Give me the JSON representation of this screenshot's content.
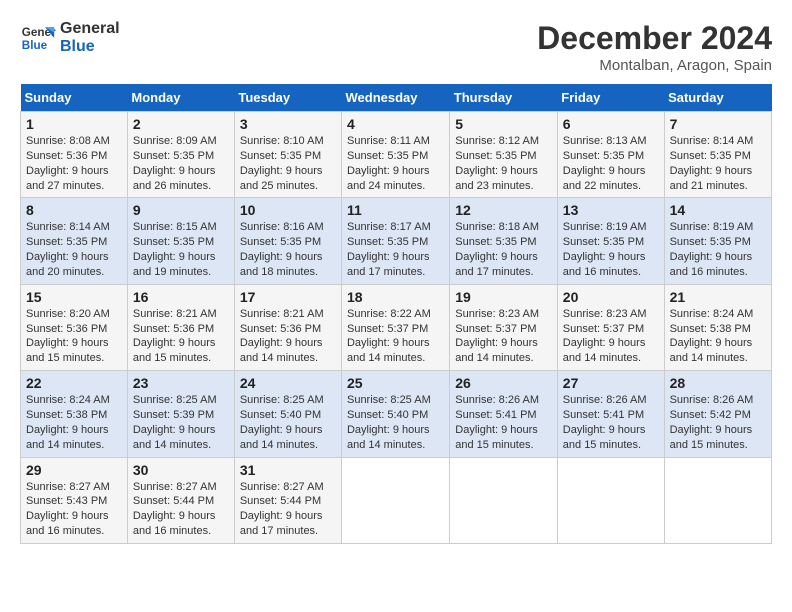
{
  "header": {
    "logo_line1": "General",
    "logo_line2": "Blue",
    "month": "December 2024",
    "location": "Montalban, Aragon, Spain"
  },
  "weekdays": [
    "Sunday",
    "Monday",
    "Tuesday",
    "Wednesday",
    "Thursday",
    "Friday",
    "Saturday"
  ],
  "weeks": [
    [
      {
        "day": "1",
        "sunrise": "Sunrise: 8:08 AM",
        "sunset": "Sunset: 5:36 PM",
        "daylight": "Daylight: 9 hours and 27 minutes."
      },
      {
        "day": "2",
        "sunrise": "Sunrise: 8:09 AM",
        "sunset": "Sunset: 5:35 PM",
        "daylight": "Daylight: 9 hours and 26 minutes."
      },
      {
        "day": "3",
        "sunrise": "Sunrise: 8:10 AM",
        "sunset": "Sunset: 5:35 PM",
        "daylight": "Daylight: 9 hours and 25 minutes."
      },
      {
        "day": "4",
        "sunrise": "Sunrise: 8:11 AM",
        "sunset": "Sunset: 5:35 PM",
        "daylight": "Daylight: 9 hours and 24 minutes."
      },
      {
        "day": "5",
        "sunrise": "Sunrise: 8:12 AM",
        "sunset": "Sunset: 5:35 PM",
        "daylight": "Daylight: 9 hours and 23 minutes."
      },
      {
        "day": "6",
        "sunrise": "Sunrise: 8:13 AM",
        "sunset": "Sunset: 5:35 PM",
        "daylight": "Daylight: 9 hours and 22 minutes."
      },
      {
        "day": "7",
        "sunrise": "Sunrise: 8:14 AM",
        "sunset": "Sunset: 5:35 PM",
        "daylight": "Daylight: 9 hours and 21 minutes."
      }
    ],
    [
      {
        "day": "8",
        "sunrise": "Sunrise: 8:14 AM",
        "sunset": "Sunset: 5:35 PM",
        "daylight": "Daylight: 9 hours and 20 minutes."
      },
      {
        "day": "9",
        "sunrise": "Sunrise: 8:15 AM",
        "sunset": "Sunset: 5:35 PM",
        "daylight": "Daylight: 9 hours and 19 minutes."
      },
      {
        "day": "10",
        "sunrise": "Sunrise: 8:16 AM",
        "sunset": "Sunset: 5:35 PM",
        "daylight": "Daylight: 9 hours and 18 minutes."
      },
      {
        "day": "11",
        "sunrise": "Sunrise: 8:17 AM",
        "sunset": "Sunset: 5:35 PM",
        "daylight": "Daylight: 9 hours and 17 minutes."
      },
      {
        "day": "12",
        "sunrise": "Sunrise: 8:18 AM",
        "sunset": "Sunset: 5:35 PM",
        "daylight": "Daylight: 9 hours and 17 minutes."
      },
      {
        "day": "13",
        "sunrise": "Sunrise: 8:19 AM",
        "sunset": "Sunset: 5:35 PM",
        "daylight": "Daylight: 9 hours and 16 minutes."
      },
      {
        "day": "14",
        "sunrise": "Sunrise: 8:19 AM",
        "sunset": "Sunset: 5:35 PM",
        "daylight": "Daylight: 9 hours and 16 minutes."
      }
    ],
    [
      {
        "day": "15",
        "sunrise": "Sunrise: 8:20 AM",
        "sunset": "Sunset: 5:36 PM",
        "daylight": "Daylight: 9 hours and 15 minutes."
      },
      {
        "day": "16",
        "sunrise": "Sunrise: 8:21 AM",
        "sunset": "Sunset: 5:36 PM",
        "daylight": "Daylight: 9 hours and 15 minutes."
      },
      {
        "day": "17",
        "sunrise": "Sunrise: 8:21 AM",
        "sunset": "Sunset: 5:36 PM",
        "daylight": "Daylight: 9 hours and 14 minutes."
      },
      {
        "day": "18",
        "sunrise": "Sunrise: 8:22 AM",
        "sunset": "Sunset: 5:37 PM",
        "daylight": "Daylight: 9 hours and 14 minutes."
      },
      {
        "day": "19",
        "sunrise": "Sunrise: 8:23 AM",
        "sunset": "Sunset: 5:37 PM",
        "daylight": "Daylight: 9 hours and 14 minutes."
      },
      {
        "day": "20",
        "sunrise": "Sunrise: 8:23 AM",
        "sunset": "Sunset: 5:37 PM",
        "daylight": "Daylight: 9 hours and 14 minutes."
      },
      {
        "day": "21",
        "sunrise": "Sunrise: 8:24 AM",
        "sunset": "Sunset: 5:38 PM",
        "daylight": "Daylight: 9 hours and 14 minutes."
      }
    ],
    [
      {
        "day": "22",
        "sunrise": "Sunrise: 8:24 AM",
        "sunset": "Sunset: 5:38 PM",
        "daylight": "Daylight: 9 hours and 14 minutes."
      },
      {
        "day": "23",
        "sunrise": "Sunrise: 8:25 AM",
        "sunset": "Sunset: 5:39 PM",
        "daylight": "Daylight: 9 hours and 14 minutes."
      },
      {
        "day": "24",
        "sunrise": "Sunrise: 8:25 AM",
        "sunset": "Sunset: 5:40 PM",
        "daylight": "Daylight: 9 hours and 14 minutes."
      },
      {
        "day": "25",
        "sunrise": "Sunrise: 8:25 AM",
        "sunset": "Sunset: 5:40 PM",
        "daylight": "Daylight: 9 hours and 14 minutes."
      },
      {
        "day": "26",
        "sunrise": "Sunrise: 8:26 AM",
        "sunset": "Sunset: 5:41 PM",
        "daylight": "Daylight: 9 hours and 15 minutes."
      },
      {
        "day": "27",
        "sunrise": "Sunrise: 8:26 AM",
        "sunset": "Sunset: 5:41 PM",
        "daylight": "Daylight: 9 hours and 15 minutes."
      },
      {
        "day": "28",
        "sunrise": "Sunrise: 8:26 AM",
        "sunset": "Sunset: 5:42 PM",
        "daylight": "Daylight: 9 hours and 15 minutes."
      }
    ],
    [
      {
        "day": "29",
        "sunrise": "Sunrise: 8:27 AM",
        "sunset": "Sunset: 5:43 PM",
        "daylight": "Daylight: 9 hours and 16 minutes."
      },
      {
        "day": "30",
        "sunrise": "Sunrise: 8:27 AM",
        "sunset": "Sunset: 5:44 PM",
        "daylight": "Daylight: 9 hours and 16 minutes."
      },
      {
        "day": "31",
        "sunrise": "Sunrise: 8:27 AM",
        "sunset": "Sunset: 5:44 PM",
        "daylight": "Daylight: 9 hours and 17 minutes."
      },
      null,
      null,
      null,
      null
    ]
  ]
}
